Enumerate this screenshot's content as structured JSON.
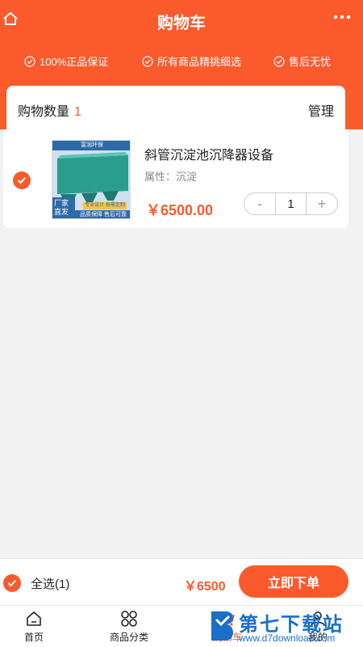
{
  "header": {
    "title": "购物车",
    "guarantees": [
      "100%正品保证",
      "所有商品精挑细选",
      "售后无忧"
    ]
  },
  "cart": {
    "count_label": "购物数量",
    "count": "1",
    "manage_label": "管理"
  },
  "item": {
    "name": "斜管沉淀池沉降器设备",
    "attribute": "属性：沉淀",
    "price": "￥6500.00",
    "quantity": "1",
    "decrement": "-",
    "increment": "+",
    "image_label_top": "富润环保",
    "image_label_left1": "厂家",
    "image_label_left2": "直发",
    "image_banner": "品质保障 售后可靠",
    "image_banner_top": "专业设计 按需定制"
  },
  "footer": {
    "select_all": "全选(1)",
    "total": "￥6500",
    "order_button": "立即下单"
  },
  "tabs": [
    {
      "label": "首页",
      "icon": "home-icon"
    },
    {
      "label": "商品分类",
      "icon": "grid-icon"
    },
    {
      "label": "购物车",
      "icon": "cart-icon"
    },
    {
      "label": "我的",
      "icon": "user-icon"
    }
  ],
  "watermark": {
    "title": "第七下载站",
    "url": "www.d7download.com"
  },
  "colors": {
    "accent": "#fb5a2c",
    "background": "#f2f2f2",
    "watermark": "#1a6fc9"
  }
}
